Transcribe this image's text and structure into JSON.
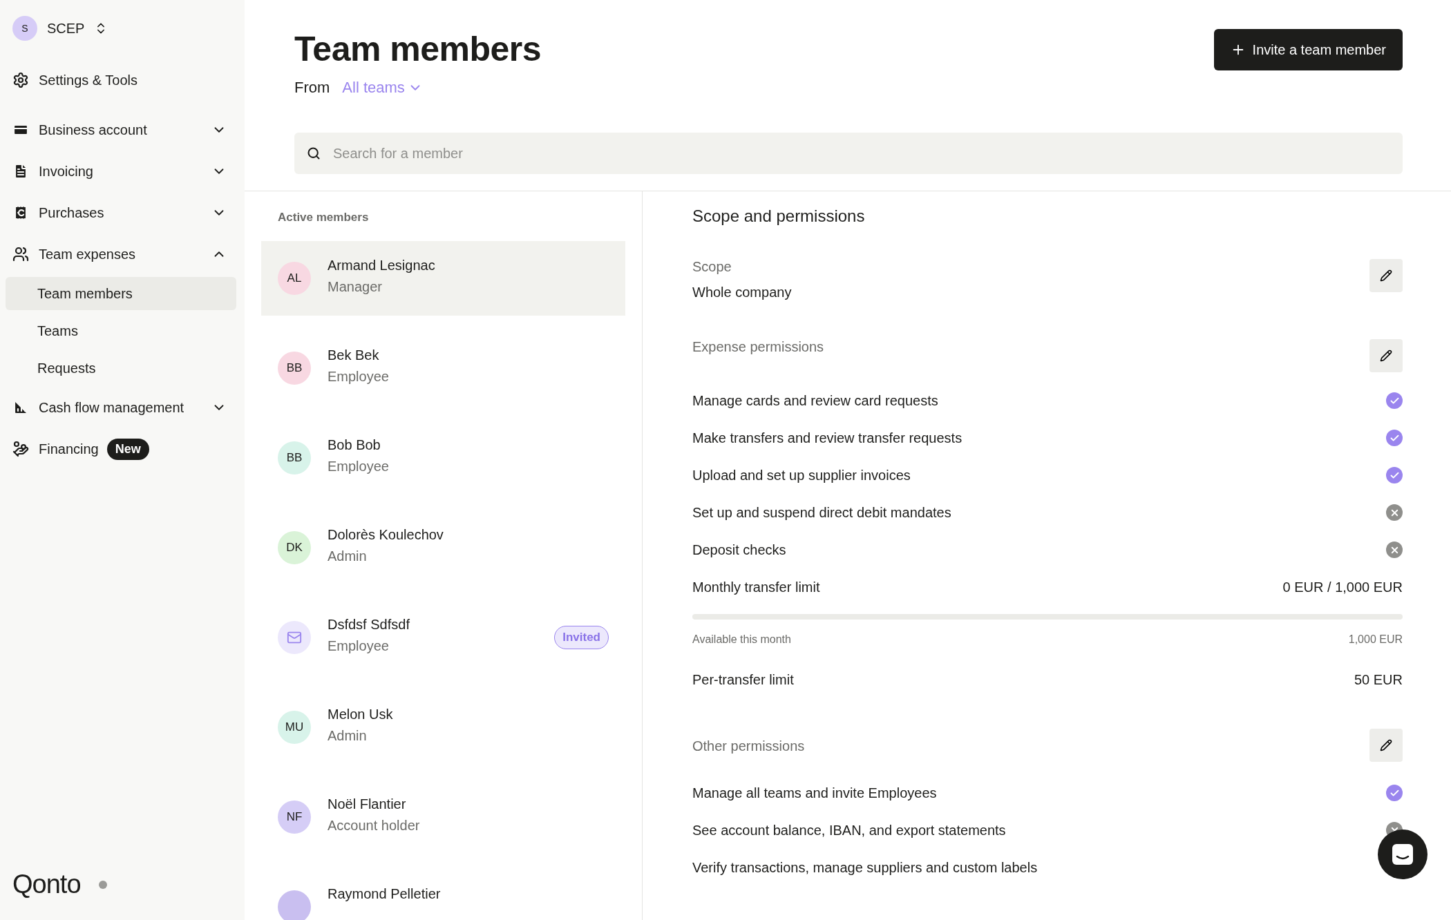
{
  "sidebar": {
    "org": {
      "avatar": "S",
      "name": "SCEP"
    },
    "items": [
      {
        "label": "Settings & Tools"
      },
      {
        "label": "Business account",
        "expanded": false
      },
      {
        "label": "Invoicing",
        "expanded": false
      },
      {
        "label": "Purchases",
        "expanded": false
      },
      {
        "label": "Team expenses",
        "expanded": true,
        "children": [
          {
            "label": "Team members",
            "selected": true
          },
          {
            "label": "Teams",
            "selected": false
          },
          {
            "label": "Requests",
            "selected": false
          }
        ]
      },
      {
        "label": "Cash flow management",
        "expanded": false
      },
      {
        "label": "Financing",
        "badge": "New"
      }
    ],
    "logo": "Qonto"
  },
  "header": {
    "title": "Team members",
    "from_label": "From",
    "team_filter": "All teams",
    "invite_button": "Invite a team member"
  },
  "search": {
    "placeholder": "Search for a member"
  },
  "members": {
    "heading": "Active members",
    "list": [
      {
        "kind": "initials",
        "avatar": "AL",
        "color": "#f8d8e2",
        "name": "Armand Lesignac",
        "role": "Manager",
        "selected": true
      },
      {
        "kind": "initials",
        "avatar": "BB",
        "color": "#f8d8e2",
        "name": "Bek Bek",
        "role": "Employee",
        "selected": false
      },
      {
        "kind": "initials",
        "avatar": "BB",
        "color": "#d8f3ea",
        "name": "Bob Bob",
        "role": "Employee",
        "selected": false
      },
      {
        "kind": "initials",
        "avatar": "DK",
        "color": "#daf3d8",
        "name": "Dolorès Koulechov",
        "role": "Admin",
        "selected": false
      },
      {
        "kind": "invited",
        "color": "#ece8fc",
        "name": "Dsfdsf Sdfsdf",
        "role": "Employee",
        "badge": "Invited",
        "selected": false
      },
      {
        "kind": "initials",
        "avatar": "MU",
        "color": "#d8f3ea",
        "name": "Melon Usk",
        "role": "Admin",
        "selected": false
      },
      {
        "kind": "initials",
        "avatar": "NF",
        "color": "#d5cdf6",
        "name": "Noël Flantier",
        "role": "Account holder",
        "selected": false
      },
      {
        "kind": "initials",
        "color": "#c9bff0",
        "name": "Raymond Pelletier",
        "selected": false
      }
    ]
  },
  "details": {
    "title": "Scope and permissions",
    "scope": {
      "label": "Scope",
      "value": "Whole company"
    },
    "expense_permissions": {
      "label": "Expense permissions",
      "items": [
        {
          "label": "Manage cards and review card requests",
          "granted": true
        },
        {
          "label": "Make transfers and review transfer requests",
          "granted": true
        },
        {
          "label": "Upload and set up supplier invoices",
          "granted": true
        },
        {
          "label": "Set up and suspend direct debit mandates",
          "granted": false
        },
        {
          "label": "Deposit checks",
          "granted": false
        }
      ],
      "monthly_limit": {
        "label": "Monthly transfer limit",
        "value": "0 EUR / 1,000 EUR",
        "level": 0,
        "available_label": "Available this month",
        "available_value": "1,000 EUR"
      },
      "per_transfer": {
        "label": "Per-transfer limit",
        "value": "50 EUR"
      }
    },
    "other_permissions": {
      "label": "Other permissions",
      "items": [
        {
          "label": "Manage all teams and invite Employees",
          "granted": true
        },
        {
          "label": "See account balance, IBAN, and export statements",
          "granted": false
        },
        {
          "label": "Verify transactions, manage suppliers and custom labels"
        }
      ]
    }
  }
}
